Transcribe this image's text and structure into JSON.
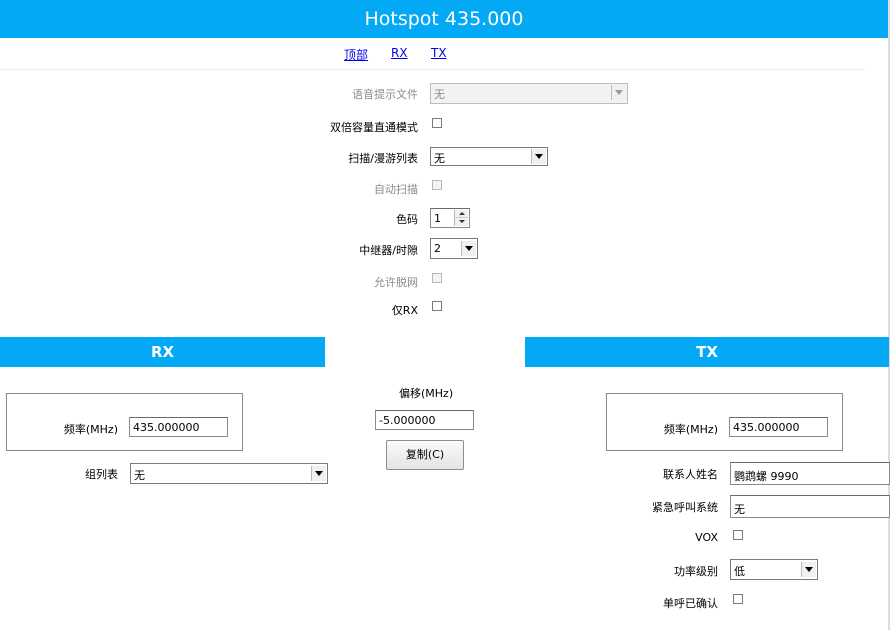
{
  "header": {
    "title": "Hotspot 435.000"
  },
  "nav": {
    "top": "顶部",
    "rx": "RX",
    "tx": "TX"
  },
  "general": {
    "voice_prompt_label": "语音提示文件",
    "voice_prompt_value": "无",
    "dual_capacity_label": "双倍容量直通模式",
    "scan_roam_label": "扫描/漫游列表",
    "scan_roam_value": "无",
    "auto_scan_label": "自动扫描",
    "color_code_label": "色码",
    "color_code_value": "1",
    "repeater_slot_label": "中继器/时隙",
    "repeater_slot_value": "2",
    "allow_talkaround_label": "允许脱网",
    "rx_only_label": "仅RX"
  },
  "rx": {
    "heading": "RX",
    "freq_label": "频率(MHz)",
    "freq_value": "435.000000",
    "group_list_label": "组列表",
    "group_list_value": "无"
  },
  "offset": {
    "label": "偏移(MHz)",
    "value": "-5.000000",
    "copy_button": "复制(C)"
  },
  "tx": {
    "heading": "TX",
    "freq_label": "频率(MHz)",
    "freq_value": "435.000000",
    "contact_label": "联系人姓名",
    "contact_value": "鹦鹉螺 9990",
    "emergency_label": "紧急呼叫系统",
    "emergency_value": "无",
    "vox_label": "VOX",
    "power_label": "功率级别",
    "power_value": "低",
    "private_call_label": "单呼已确认"
  }
}
